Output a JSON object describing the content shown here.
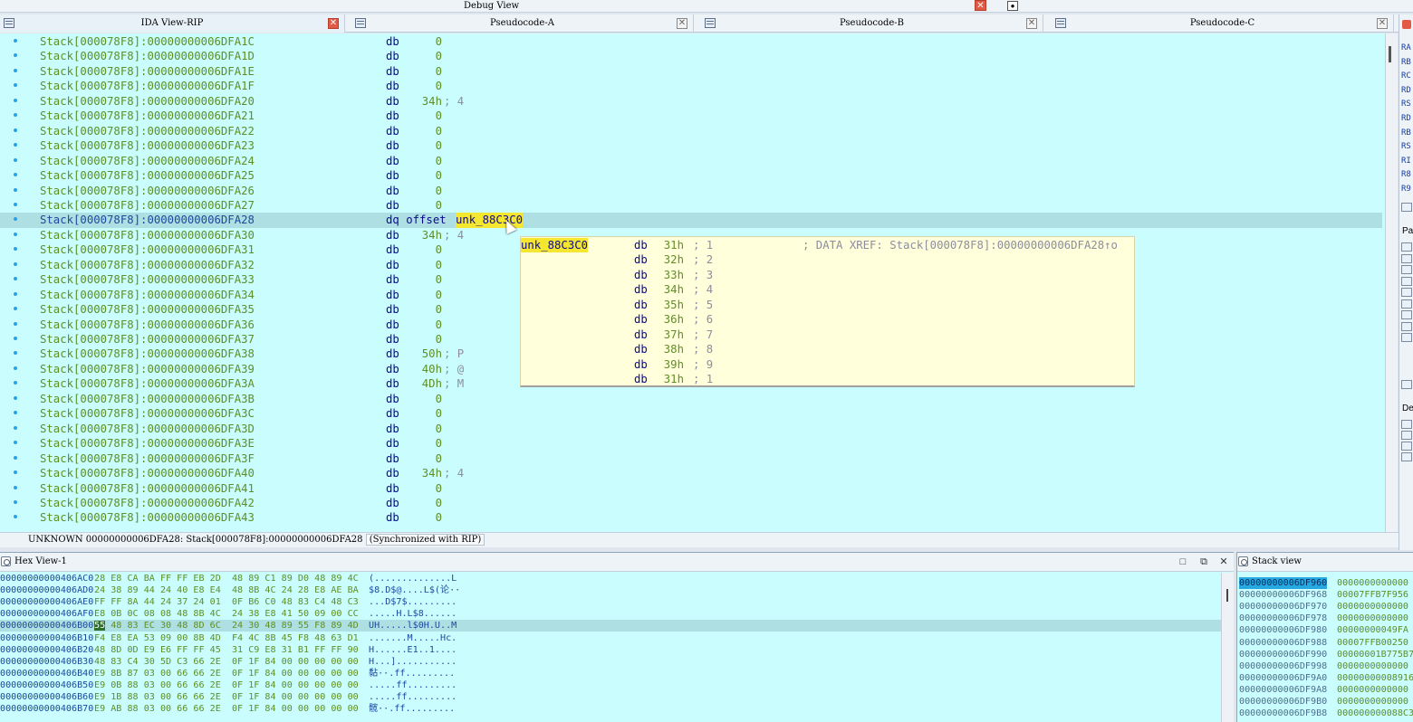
{
  "window": {
    "title": "Debug View"
  },
  "tabs": [
    {
      "label": "IDA View-RIP",
      "active": true
    },
    {
      "label": "Pseudocode-A"
    },
    {
      "label": "Pseudocode-B"
    },
    {
      "label": "Pseudocode-C"
    }
  ],
  "disasm": {
    "rows": [
      {
        "addr": "Stack[000078F8]:00000000006DFA1C",
        "ins": "db",
        "val": "0",
        "cmt": ""
      },
      {
        "addr": "Stack[000078F8]:00000000006DFA1D",
        "ins": "db",
        "val": "0",
        "cmt": ""
      },
      {
        "addr": "Stack[000078F8]:00000000006DFA1E",
        "ins": "db",
        "val": "0",
        "cmt": ""
      },
      {
        "addr": "Stack[000078F8]:00000000006DFA1F",
        "ins": "db",
        "val": "0",
        "cmt": ""
      },
      {
        "addr": "Stack[000078F8]:00000000006DFA20",
        "ins": "db",
        "val": "34h",
        "cmt": "; 4"
      },
      {
        "addr": "Stack[000078F8]:00000000006DFA21",
        "ins": "db",
        "val": "0",
        "cmt": ""
      },
      {
        "addr": "Stack[000078F8]:00000000006DFA22",
        "ins": "db",
        "val": "0",
        "cmt": ""
      },
      {
        "addr": "Stack[000078F8]:00000000006DFA23",
        "ins": "db",
        "val": "0",
        "cmt": ""
      },
      {
        "addr": "Stack[000078F8]:00000000006DFA24",
        "ins": "db",
        "val": "0",
        "cmt": ""
      },
      {
        "addr": "Stack[000078F8]:00000000006DFA25",
        "ins": "db",
        "val": "0",
        "cmt": ""
      },
      {
        "addr": "Stack[000078F8]:00000000006DFA26",
        "ins": "db",
        "val": "0",
        "cmt": ""
      },
      {
        "addr": "Stack[000078F8]:00000000006DFA27",
        "ins": "db",
        "val": "0",
        "cmt": ""
      },
      {
        "addr": "Stack[000078F8]:00000000006DFA28",
        "ins": "dq offset",
        "val": "",
        "ref": "unk_88C3C0",
        "cmt": "",
        "selected": true
      },
      {
        "addr": "Stack[000078F8]:00000000006DFA30",
        "ins": "db",
        "val": "34h",
        "cmt": "; 4"
      },
      {
        "addr": "Stack[000078F8]:00000000006DFA31",
        "ins": "db",
        "val": "0",
        "cmt": ""
      },
      {
        "addr": "Stack[000078F8]:00000000006DFA32",
        "ins": "db",
        "val": "0",
        "cmt": ""
      },
      {
        "addr": "Stack[000078F8]:00000000006DFA33",
        "ins": "db",
        "val": "0",
        "cmt": ""
      },
      {
        "addr": "Stack[000078F8]:00000000006DFA34",
        "ins": "db",
        "val": "0",
        "cmt": ""
      },
      {
        "addr": "Stack[000078F8]:00000000006DFA35",
        "ins": "db",
        "val": "0",
        "cmt": ""
      },
      {
        "addr": "Stack[000078F8]:00000000006DFA36",
        "ins": "db",
        "val": "0",
        "cmt": ""
      },
      {
        "addr": "Stack[000078F8]:00000000006DFA37",
        "ins": "db",
        "val": "0",
        "cmt": ""
      },
      {
        "addr": "Stack[000078F8]:00000000006DFA38",
        "ins": "db",
        "val": "50h",
        "cmt": "; P"
      },
      {
        "addr": "Stack[000078F8]:00000000006DFA39",
        "ins": "db",
        "val": "40h",
        "cmt": "; @"
      },
      {
        "addr": "Stack[000078F8]:00000000006DFA3A",
        "ins": "db",
        "val": "4Dh",
        "cmt": "; M"
      },
      {
        "addr": "Stack[000078F8]:00000000006DFA3B",
        "ins": "db",
        "val": "0",
        "cmt": ""
      },
      {
        "addr": "Stack[000078F8]:00000000006DFA3C",
        "ins": "db",
        "val": "0",
        "cmt": ""
      },
      {
        "addr": "Stack[000078F8]:00000000006DFA3D",
        "ins": "db",
        "val": "0",
        "cmt": ""
      },
      {
        "addr": "Stack[000078F8]:00000000006DFA3E",
        "ins": "db",
        "val": "0",
        "cmt": ""
      },
      {
        "addr": "Stack[000078F8]:00000000006DFA3F",
        "ins": "db",
        "val": "0",
        "cmt": ""
      },
      {
        "addr": "Stack[000078F8]:00000000006DFA40",
        "ins": "db",
        "val": "34h",
        "cmt": "; 4"
      },
      {
        "addr": "Stack[000078F8]:00000000006DFA41",
        "ins": "db",
        "val": "0",
        "cmt": ""
      },
      {
        "addr": "Stack[000078F8]:00000000006DFA42",
        "ins": "db",
        "val": "0",
        "cmt": ""
      },
      {
        "addr": "Stack[000078F8]:00000000006DFA43",
        "ins": "db",
        "val": "0",
        "cmt": ""
      }
    ]
  },
  "tooltip": {
    "label": "unk_88C3C0",
    "xref": "; DATA XREF: Stack[000078F8]:00000000006DFA28↑o",
    "rows": [
      {
        "ins": "db",
        "val": "31h",
        "cmt": "; 1"
      },
      {
        "ins": "db",
        "val": "32h",
        "cmt": "; 2"
      },
      {
        "ins": "db",
        "val": "33h",
        "cmt": "; 3"
      },
      {
        "ins": "db",
        "val": "34h",
        "cmt": "; 4"
      },
      {
        "ins": "db",
        "val": "35h",
        "cmt": "; 5"
      },
      {
        "ins": "db",
        "val": "36h",
        "cmt": "; 6"
      },
      {
        "ins": "db",
        "val": "37h",
        "cmt": "; 7"
      },
      {
        "ins": "db",
        "val": "38h",
        "cmt": "; 8"
      },
      {
        "ins": "db",
        "val": "39h",
        "cmt": "; 9"
      },
      {
        "ins": "db",
        "val": "31h",
        "cmt": "; 1"
      }
    ]
  },
  "status": {
    "text": "UNKNOWN 00000000006DFA28: Stack[000078F8]:00000000006DFA28",
    "sync": "(Synchronized with RIP)"
  },
  "right_panel": {
    "registers": [
      "RA",
      "RB",
      "RC",
      "RD",
      "RS",
      "RD",
      "RB",
      "RS",
      "RI",
      "R8",
      "R9"
    ],
    "headers": [
      "Pa",
      "De"
    ]
  },
  "hex_view": {
    "title": "Hex View-1",
    "rows": [
      {
        "addr": "00000000000406AC0",
        "bytes": "28 E8 CA BA FF FF EB 2D  48 89 C1 89 D0 48 89 4C",
        "ascii": "(..............L"
      },
      {
        "addr": "00000000000406AD0",
        "bytes": "24 38 89 44 24 40 E8 E4  48 8B 4C 24 28 E8 AE BA",
        "ascii": "$8.D$@....L$(论··"
      },
      {
        "addr": "00000000000406AE0",
        "bytes": "FF FF 8A 44 24 37 24 01  0F B6 C0 48 83 C4 48 C3",
        "ascii": "...D$7$........."
      },
      {
        "addr": "00000000000406AF0",
        "bytes": "E8 0B 0C 08 08 48 8B 4C  24 38 E8 41 50 09 00 CC",
        "ascii": ".....H.L$8......"
      },
      {
        "addr": "00000000000406B00",
        "bytes": "55 48 83 EC 30 48 8D 6C  24 30 48 89 55 F8 89 4D",
        "ascii": "UH.....l$0H.U..M",
        "selected": true
      },
      {
        "addr": "00000000000406B10",
        "bytes": "F4 E8 EA 53 09 00 8B 4D  F4 4C 8B 45 F8 48 63 D1",
        "ascii": ".......M.....Hc."
      },
      {
        "addr": "00000000000406B20",
        "bytes": "48 8D 0D E9 E6 FF FF 45  31 C9 E8 31 B1 FF FF 90",
        "ascii": "H......E1..1...."
      },
      {
        "addr": "00000000000406B30",
        "bytes": "48 83 C4 30 5D C3 66 2E  0F 1F 84 00 00 00 00 00",
        "ascii": "H...]..........."
      },
      {
        "addr": "00000000000406B40",
        "bytes": "E9 8B 87 03 00 66 66 2E  0F 1F 84 00 00 00 00 00",
        "ascii": "黏··.ff........."
      },
      {
        "addr": "00000000000406B50",
        "bytes": "E9 0B 88 03 00 66 66 2E  0F 1F 84 00 00 00 00 00",
        "ascii": ".....ff........."
      },
      {
        "addr": "00000000000406B60",
        "bytes": "E9 1B 88 03 00 66 66 2E  0F 1F 84 00 00 00 00 00",
        "ascii": ".....ff........."
      },
      {
        "addr": "00000000000406B70",
        "bytes": "E9 AB 88 03 00 66 66 2E  0F 1F 84 00 00 00 00 00",
        "ascii": "髋··.ff........."
      }
    ]
  },
  "stack_view": {
    "title": "Stack view",
    "rows": [
      {
        "addr": "00000000006DF960",
        "val": "0000000000000",
        "selected": true
      },
      {
        "addr": "00000000006DF968",
        "val": "00007FFB7F956"
      },
      {
        "addr": "00000000006DF970",
        "val": "0000000000000"
      },
      {
        "addr": "00000000006DF978",
        "val": "0000000000000"
      },
      {
        "addr": "00000000006DF980",
        "val": "00000000049FA"
      },
      {
        "addr": "00000000006DF988",
        "val": "00007FFB00250"
      },
      {
        "addr": "00000000006DF990",
        "val": "00000001B775B7"
      },
      {
        "addr": "00000000006DF998",
        "val": "0000000000000"
      },
      {
        "addr": "00000000006DF9A0",
        "val": "00000000008916"
      },
      {
        "addr": "00000000006DF9A8",
        "val": "0000000000000"
      },
      {
        "addr": "00000000006DF9B0",
        "val": "0000000000000"
      },
      {
        "addr": "00000000006DF9B8",
        "val": "000000000088C3"
      }
    ]
  },
  "colors": {
    "listing_bg": "#c9fdfe",
    "highlight": "#f5e630",
    "tooltip_bg": "#ffffdc"
  }
}
